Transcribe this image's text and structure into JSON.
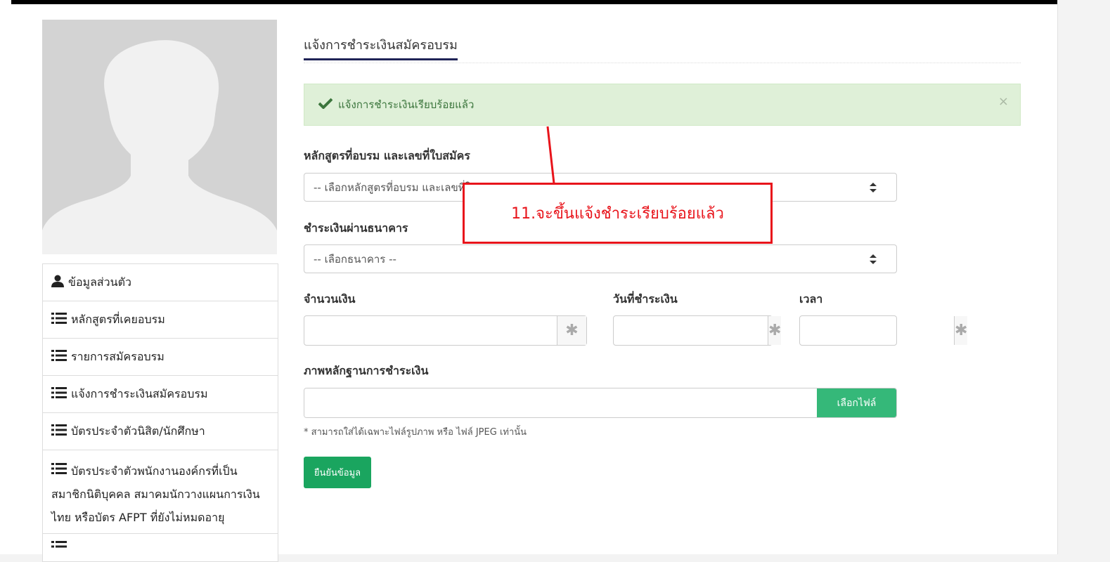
{
  "sidebar": {
    "items": [
      {
        "label": "ข้อมูลส่วนตัว",
        "icon": "user-icon"
      },
      {
        "label": "หลักสูตรที่เคยอบรม",
        "icon": "list-icon"
      },
      {
        "label": "รายการสมัครอบรม",
        "icon": "list-icon"
      },
      {
        "label": "แจ้งการชำระเงินสมัครอบรม",
        "icon": "list-icon"
      },
      {
        "label": "บัตรประจำตัวนิสิต/นักศึกษา",
        "icon": "list-icon"
      },
      {
        "label": "บัตรประจำตัวพนักงานองค์กรที่เป็นสมาชิกนิติบุคคล สมาคมนักวางแผนการเงินไทย หรือบัตร AFPT ที่ยังไม่หมดอายุ",
        "icon": "list-icon"
      }
    ]
  },
  "tab": {
    "active_label": "แจ้งการชำระเงินสมัครอบรม"
  },
  "alert": {
    "message": "แจ้งการชำระเงินเรียบร้อยแล้ว",
    "close": "×"
  },
  "form": {
    "course": {
      "label": "หลักสูตรที่อบรม และเลขที่ใบสมัคร",
      "placeholder": "-- เลือกหลักสูตรที่อบรม และเลขที่ใบสมัคร --"
    },
    "bank": {
      "label": "ชำระเงินผ่านธนาคาร",
      "placeholder": "-- เลือกธนาคาร --"
    },
    "amount": {
      "label": "จำนวนเงิน",
      "value": "",
      "addon": "✱"
    },
    "pay_date": {
      "label": "วันที่ชำระเงิน",
      "value": "",
      "addon": "✱"
    },
    "time": {
      "label": "เวลา",
      "value": "",
      "addon": "✱"
    },
    "evidence": {
      "label": "ภาพหลักฐานการชำระเงิน",
      "value": "",
      "button": "เลือกไฟล์"
    },
    "note": "* สามารถใส่ได้เฉพาะไฟล์รูปภาพ หรือ ไฟล์ JPEG เท่านั้น",
    "submit": "ยืนยันข้อมูล"
  },
  "annotation": {
    "text": "11.จะขึ้นแจ้งชำระเรียบร้อยแล้ว",
    "color": "#e8141b"
  },
  "colors": {
    "success_bg": "#dff0d8",
    "success_text": "#3c763d",
    "file_button": "#35b879",
    "submit_button": "#1aa55f",
    "tab_underline": "#1f2356"
  }
}
